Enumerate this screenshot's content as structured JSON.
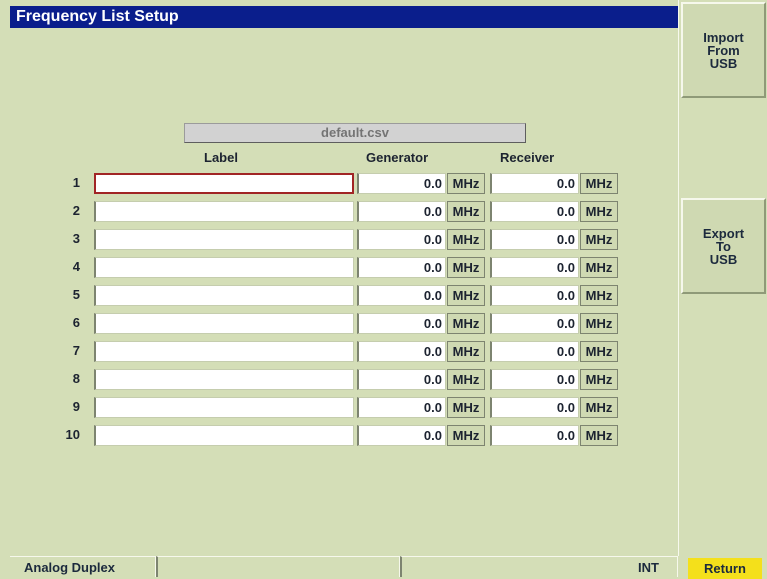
{
  "window": {
    "title": "Frequency List Setup"
  },
  "file": {
    "name": "default.csv"
  },
  "columns": {
    "label": "Label",
    "generator": "Generator",
    "receiver": "Receiver"
  },
  "rows": [
    {
      "num": "1",
      "label": "",
      "generator": "0.0",
      "generator_unit": "MHz",
      "receiver": "0.0",
      "receiver_unit": "MHz",
      "selected": true
    },
    {
      "num": "2",
      "label": "",
      "generator": "0.0",
      "generator_unit": "MHz",
      "receiver": "0.0",
      "receiver_unit": "MHz"
    },
    {
      "num": "3",
      "label": "",
      "generator": "0.0",
      "generator_unit": "MHz",
      "receiver": "0.0",
      "receiver_unit": "MHz"
    },
    {
      "num": "4",
      "label": "",
      "generator": "0.0",
      "generator_unit": "MHz",
      "receiver": "0.0",
      "receiver_unit": "MHz"
    },
    {
      "num": "5",
      "label": "",
      "generator": "0.0",
      "generator_unit": "MHz",
      "receiver": "0.0",
      "receiver_unit": "MHz"
    },
    {
      "num": "6",
      "label": "",
      "generator": "0.0",
      "generator_unit": "MHz",
      "receiver": "0.0",
      "receiver_unit": "MHz"
    },
    {
      "num": "7",
      "label": "",
      "generator": "0.0",
      "generator_unit": "MHz",
      "receiver": "0.0",
      "receiver_unit": "MHz"
    },
    {
      "num": "8",
      "label": "",
      "generator": "0.0",
      "generator_unit": "MHz",
      "receiver": "0.0",
      "receiver_unit": "MHz"
    },
    {
      "num": "9",
      "label": "",
      "generator": "0.0",
      "generator_unit": "MHz",
      "receiver": "0.0",
      "receiver_unit": "MHz"
    },
    {
      "num": "10",
      "label": "",
      "generator": "0.0",
      "generator_unit": "MHz",
      "receiver": "0.0",
      "receiver_unit": "MHz"
    }
  ],
  "softkeys": {
    "import": "Import\nFrom\nUSB",
    "export": "Export\nTo\nUSB",
    "return": "Return"
  },
  "status": {
    "mode": "Analog Duplex",
    "reference": "INT"
  },
  "colors": {
    "title_bar": "#0a1e8c",
    "background": "#d4deb7",
    "selected_border": "#a12525",
    "return_key": "#f4e01b"
  }
}
